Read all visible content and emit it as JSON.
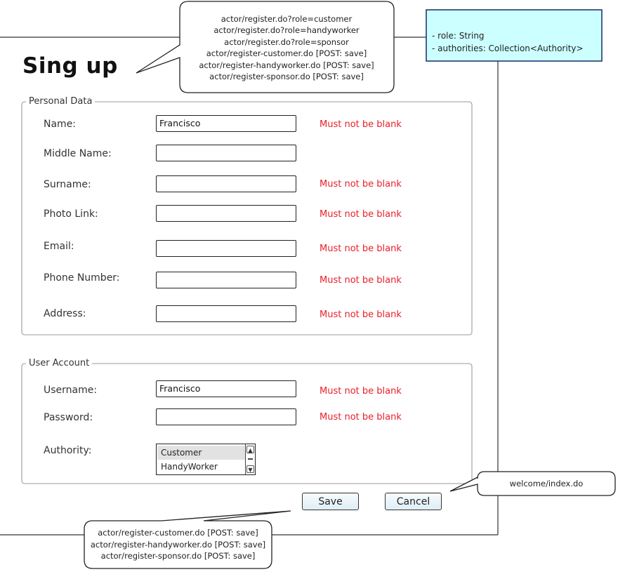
{
  "page": {
    "title": "Sing up"
  },
  "top_callout": {
    "lines": [
      "actor/register.do?role=customer",
      "actor/register.do?role=handyworker",
      "actor/register.do?role=sponsor",
      "actor/register-customer.do [POST: save]",
      "actor/register-handyworker.do [POST: save]",
      "actor/register-sponsor.do [POST: save]"
    ]
  },
  "model_note": {
    "lines": [
      "- role: String",
      "- authorities: Collection<Authority>"
    ],
    "fill": "#ccffff",
    "border": "#1f3a6e"
  },
  "personal_data": {
    "legend": "Personal Data",
    "fields": [
      {
        "label": "Name:",
        "value": "Francisco",
        "error": "Must not be blank"
      },
      {
        "label": "Middle Name:",
        "value": "",
        "error": ""
      },
      {
        "label": "Surname:",
        "value": "",
        "error": "Must not be blank"
      },
      {
        "label": "Photo Link:",
        "value": "",
        "error": "Must not be blank"
      },
      {
        "label": "Email:",
        "value": "",
        "error": "Must not be blank"
      },
      {
        "label": "Phone Number:",
        "value": "",
        "error": "Must not be blank"
      },
      {
        "label": "Address:",
        "value": "",
        "error": "Must not be blank"
      }
    ]
  },
  "user_account": {
    "legend": "User Account",
    "username": {
      "label": "Username:",
      "value": "Francisco",
      "error": "Must not be blank"
    },
    "password": {
      "label": "Password:",
      "value": "",
      "error": "Must not be blank"
    },
    "authority": {
      "label": "Authority:",
      "options": [
        "Customer",
        "HandyWorker"
      ],
      "selected": "Customer"
    }
  },
  "buttons": {
    "save": "Save",
    "cancel": "Cancel"
  },
  "cancel_callout": {
    "text": "welcome/index.do"
  },
  "save_callout": {
    "lines": [
      "actor/register-customer.do [POST: save]",
      "actor/register-handyworker.do [POST: save]",
      "actor/register-sponsor.do [POST: save]"
    ]
  },
  "colors": {
    "error": "#e8202a",
    "button_fill": "#e6f2f8",
    "selected_option": "#e2e2e2"
  }
}
